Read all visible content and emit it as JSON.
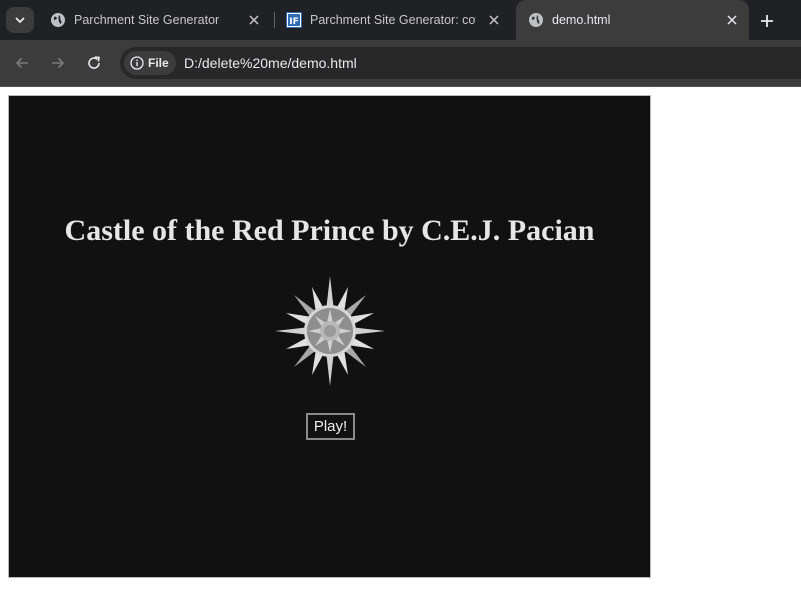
{
  "browser": {
    "tabs": [
      {
        "title": "Parchment Site Generator",
        "favicon": "globe-icon",
        "active": false
      },
      {
        "title": "Parchment Site Generator: cove",
        "favicon": "if-logo-icon",
        "active": false
      },
      {
        "title": "demo.html",
        "favicon": "globe-icon",
        "active": true
      }
    ],
    "chip_label": "File",
    "url": "D:/delete%20me/demo.html"
  },
  "page": {
    "title": "Castle of the Red Prince by C.E.J. Pacian",
    "cover_icon": "compass-rose-icon",
    "play_label": "Play!"
  }
}
